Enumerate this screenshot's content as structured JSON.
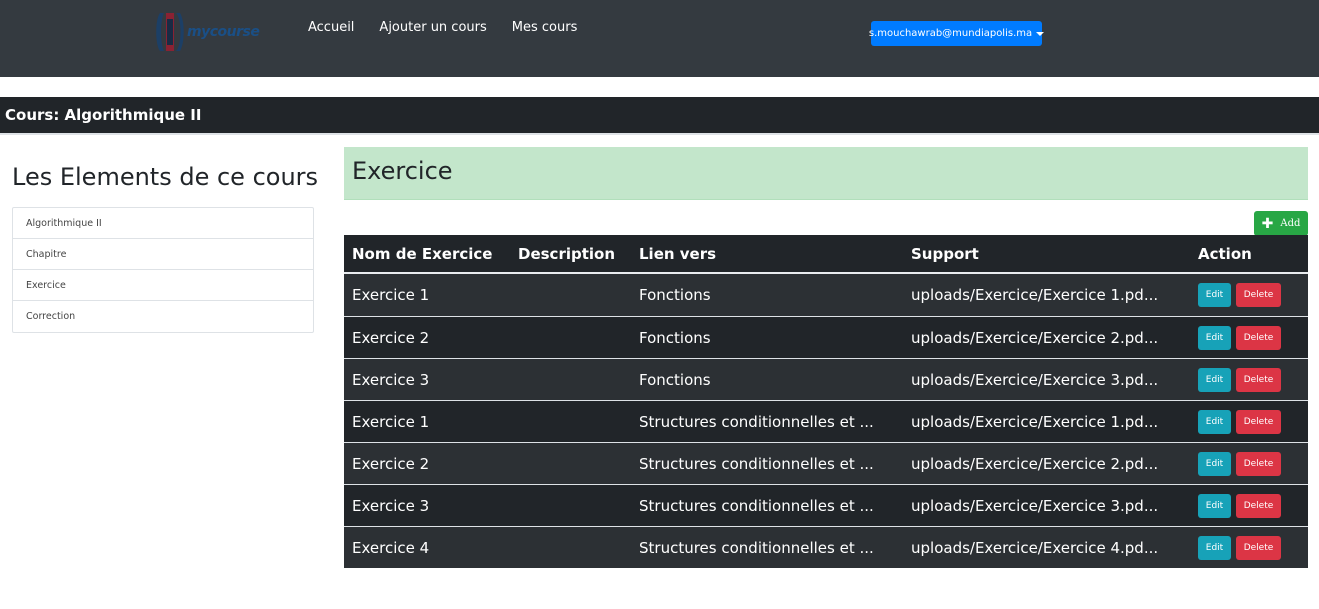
{
  "brand": {
    "logo_text": "mycourse"
  },
  "nav": {
    "links": [
      {
        "label": "Accueil"
      },
      {
        "label": "Ajouter un cours"
      },
      {
        "label": "Mes cours"
      }
    ],
    "user_email": "s.mouchawrab@mundiapolis.ma"
  },
  "course": {
    "title": "Cours: Algorithmique II"
  },
  "sidebar": {
    "heading": "Les Elements de ce cours",
    "items": [
      {
        "label": "Algorithmique II"
      },
      {
        "label": "Chapitre"
      },
      {
        "label": "Exercice"
      },
      {
        "label": "Correction"
      }
    ]
  },
  "section": {
    "title": "Exercice",
    "add_label": "Add",
    "add_icon": "plus-icon"
  },
  "table": {
    "headers": [
      "Nom de Exercice",
      "Description",
      "Lien vers",
      "Support",
      "Action"
    ],
    "edit_label": "Edit",
    "delete_label": "Delete",
    "rows": [
      {
        "name": "Exercice 1",
        "description": "",
        "link": "Fonctions",
        "support": "uploads/Exercice/Exercice 1.pd..."
      },
      {
        "name": "Exercice 2",
        "description": "",
        "link": "Fonctions",
        "support": "uploads/Exercice/Exercice 2.pd..."
      },
      {
        "name": "Exercice 3",
        "description": "",
        "link": "Fonctions",
        "support": "uploads/Exercice/Exercice 3.pd..."
      },
      {
        "name": "Exercice 1",
        "description": "",
        "link": "Structures conditionnelles et ...",
        "support": "uploads/Exercice/Exercice 1.pd..."
      },
      {
        "name": "Exercice 2",
        "description": "",
        "link": "Structures conditionnelles et ...",
        "support": "uploads/Exercice/Exercice 2.pd..."
      },
      {
        "name": "Exercice 3",
        "description": "",
        "link": "Structures conditionnelles et ...",
        "support": "uploads/Exercice/Exercice 3.pd..."
      },
      {
        "name": "Exercice 4",
        "description": "",
        "link": "Structures conditionnelles et ...",
        "support": "uploads/Exercice/Exercice 4.pd..."
      }
    ]
  },
  "colors": {
    "navbar": "#343a40",
    "course_bar": "#212529",
    "section_header": "#c3e6cb",
    "primary": "#007bff",
    "success": "#28a745",
    "info": "#17a2b8",
    "danger": "#dc3545"
  }
}
